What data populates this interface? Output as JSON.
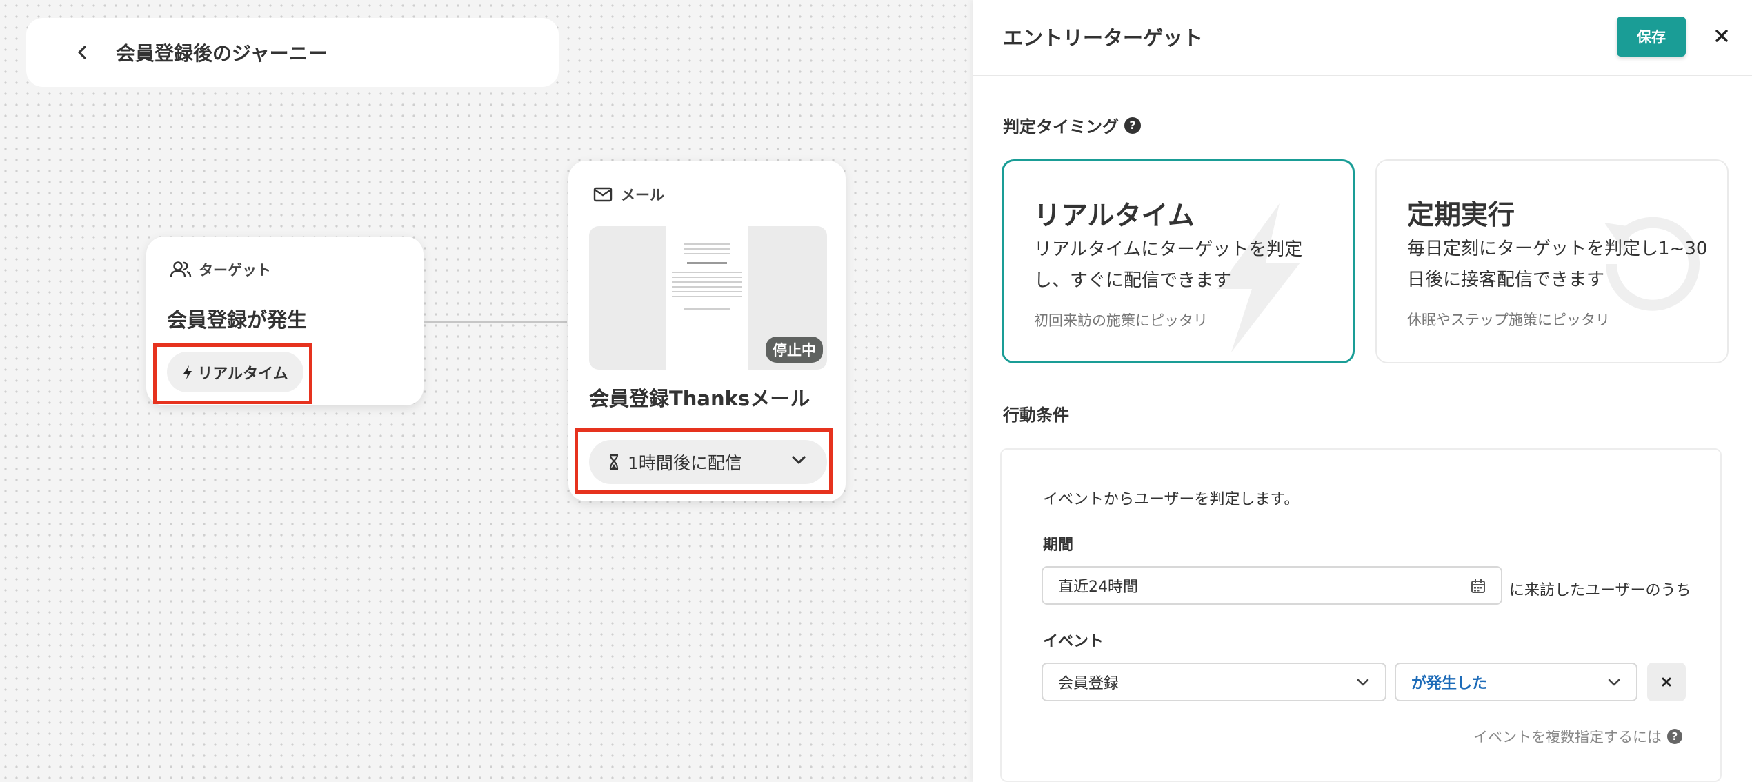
{
  "journey": {
    "title": "会員登録後のジャーニー"
  },
  "target_node": {
    "header": "ターゲット",
    "title": "会員登録が発生",
    "badge": "リアルタイム"
  },
  "mail_node": {
    "header": "メール",
    "title": "会員登録Thanksメール",
    "status": "停止中",
    "delay": "1時間後に配信"
  },
  "panel": {
    "title": "エントリーターゲット",
    "save_label": "保存",
    "timing_label": "判定タイミング",
    "timing_options": [
      {
        "title": "リアルタイム",
        "desc": "リアルタイムにターゲットを判定し、すぐに配信できます",
        "note": "初回来訪の施策にピッタリ",
        "selected": true
      },
      {
        "title": "定期実行",
        "desc": "毎日定刻にターゲットを判定し1~30日後に接客配信できます",
        "note": "休眠やステップ施策にピッタリ",
        "selected": false
      }
    ],
    "condition": {
      "label": "行動条件",
      "desc": "イベントからユーザーを判定します。",
      "period_label": "期間",
      "period_value": "直近24時間",
      "period_suffix": "に来訪したユーザーのうち",
      "event_label": "イベント",
      "event_value": "会員登録",
      "occurrence_value": "が発生した",
      "multi_link": "イベントを複数指定するには"
    }
  },
  "colors": {
    "accent": "#1a9d96",
    "highlight": "#e6321e",
    "link_blue": "#1d6bb8"
  }
}
